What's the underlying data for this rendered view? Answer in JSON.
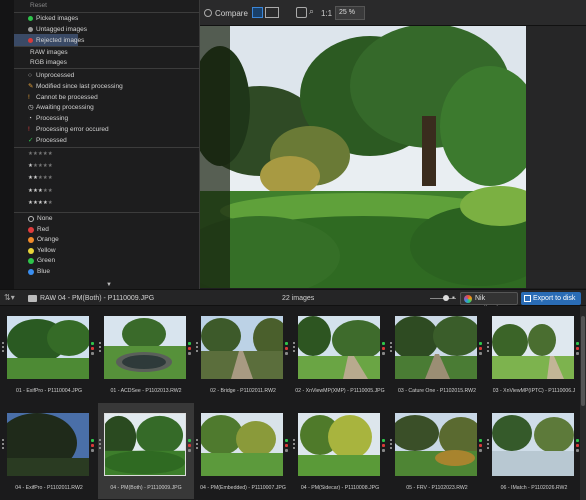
{
  "toolbar": {
    "compare_label": "Compare",
    "zoom_11": "1:1",
    "zoom_value": "25 %"
  },
  "menu": {
    "reset": "Reset",
    "flags": [
      {
        "label": "Picked images",
        "color": "#2ec44b"
      },
      {
        "label": "Untagged images",
        "color": "#9a9a9a"
      },
      {
        "label": "Rejected images",
        "color": "#d83a3a"
      }
    ],
    "types": [
      "RAW images",
      "RGB images"
    ],
    "status": [
      {
        "label": "Unprocessed",
        "icon": "circle-outline-icon",
        "color": "#cccccc"
      },
      {
        "label": "Modified since last processing",
        "icon": "pencil-icon",
        "color": "#e8a33a"
      },
      {
        "label": "Cannot be processed",
        "icon": "exclamation-icon",
        "color": "#e8a33a"
      },
      {
        "label": "Awaiting processing",
        "icon": "clock-icon",
        "color": "#cccccc"
      },
      {
        "label": "Processing",
        "icon": "spinner-icon",
        "color": "#cccccc"
      },
      {
        "label": "Processing error occured",
        "icon": "error-icon",
        "color": "#e04040"
      },
      {
        "label": "Processed",
        "icon": "check-icon",
        "color": "#2ec44b"
      }
    ],
    "ratings": [
      0,
      1,
      2,
      3,
      4
    ],
    "colors": [
      {
        "label": "None",
        "color": "none"
      },
      {
        "label": "Red",
        "color": "#e03c3c"
      },
      {
        "label": "Orange",
        "color": "#f08a2a"
      },
      {
        "label": "Yellow",
        "color": "#e8d43a"
      },
      {
        "label": "Green",
        "color": "#2ec44b"
      },
      {
        "label": "Blue",
        "color": "#3a8ef0"
      }
    ]
  },
  "strip": {
    "source": "RAW",
    "path": "04 - PM(Both) - P1110009.JPG",
    "count": "22 images",
    "nik_label": "Nik Collection",
    "export_label": "Export to disk"
  },
  "thumbnails": [
    {
      "caption": "01 - ExifPro - P1110004.JPG",
      "scene": "park",
      "selected": false,
      "marks": [
        "#2ec44b",
        "#d83a3a",
        "#888888"
      ]
    },
    {
      "caption": "01 - ACDSee - P1102013.RW2",
      "scene": "pond",
      "selected": false,
      "marks": [
        "#2ec44b",
        "#d83a3a",
        "#888888"
      ]
    },
    {
      "caption": "02 - Bridge - P1102011.RW2",
      "scene": "path",
      "selected": false,
      "marks": [
        "#2ec44b",
        "#d83a3a",
        "#888888"
      ]
    },
    {
      "caption": "02 - XnViewMP(XMP) - P1110005.JPG",
      "scene": "lawn",
      "selected": false,
      "marks": [
        "#2ec44b",
        "#d83a3a",
        "#888888"
      ]
    },
    {
      "caption": "03 - Cature One - P1102015.RW2",
      "scene": "trees",
      "selected": false,
      "marks": [
        "#2ec44b",
        "#d83a3a",
        "#888888"
      ]
    },
    {
      "caption": "03 - XnViewMP(IPTC) - P1110006.J",
      "scene": "lawn2",
      "selected": false,
      "marks": [
        "#2ec44b",
        "#d83a3a",
        "#888888"
      ]
    },
    {
      "caption": "04 - ExifPro - P1102011.RW2",
      "scene": "dark",
      "selected": false,
      "marks": [
        "#2ec44b",
        "#d83a3a",
        "#888888"
      ]
    },
    {
      "caption": "04 - PM(Both) - P1110009.JPG",
      "scene": "garden",
      "selected": true,
      "marks": [
        "#2ec44b",
        "#d83a3a",
        "#888888"
      ]
    },
    {
      "caption": "04 - PM(Embedded) - P1110007.JPG",
      "scene": "shrubs",
      "selected": false,
      "marks": [
        "#2ec44b",
        "#d83a3a",
        "#888888"
      ]
    },
    {
      "caption": "04 - PM(Sidecar) - P1110008.JPG",
      "scene": "yellowtree",
      "selected": false,
      "marks": [
        "#2ec44b",
        "#d83a3a",
        "#888888"
      ]
    },
    {
      "caption": "05 - FRV - P1102023.RW2",
      "scene": "hill",
      "selected": false,
      "marks": [
        "#2ec44b",
        "#d83a3a",
        "#888888"
      ]
    },
    {
      "caption": "06 - IMatch - P1102026.RW2",
      "scene": "frost",
      "selected": false,
      "marks": [
        "#2ec44b",
        "#d83a3a",
        "#888888"
      ]
    }
  ]
}
